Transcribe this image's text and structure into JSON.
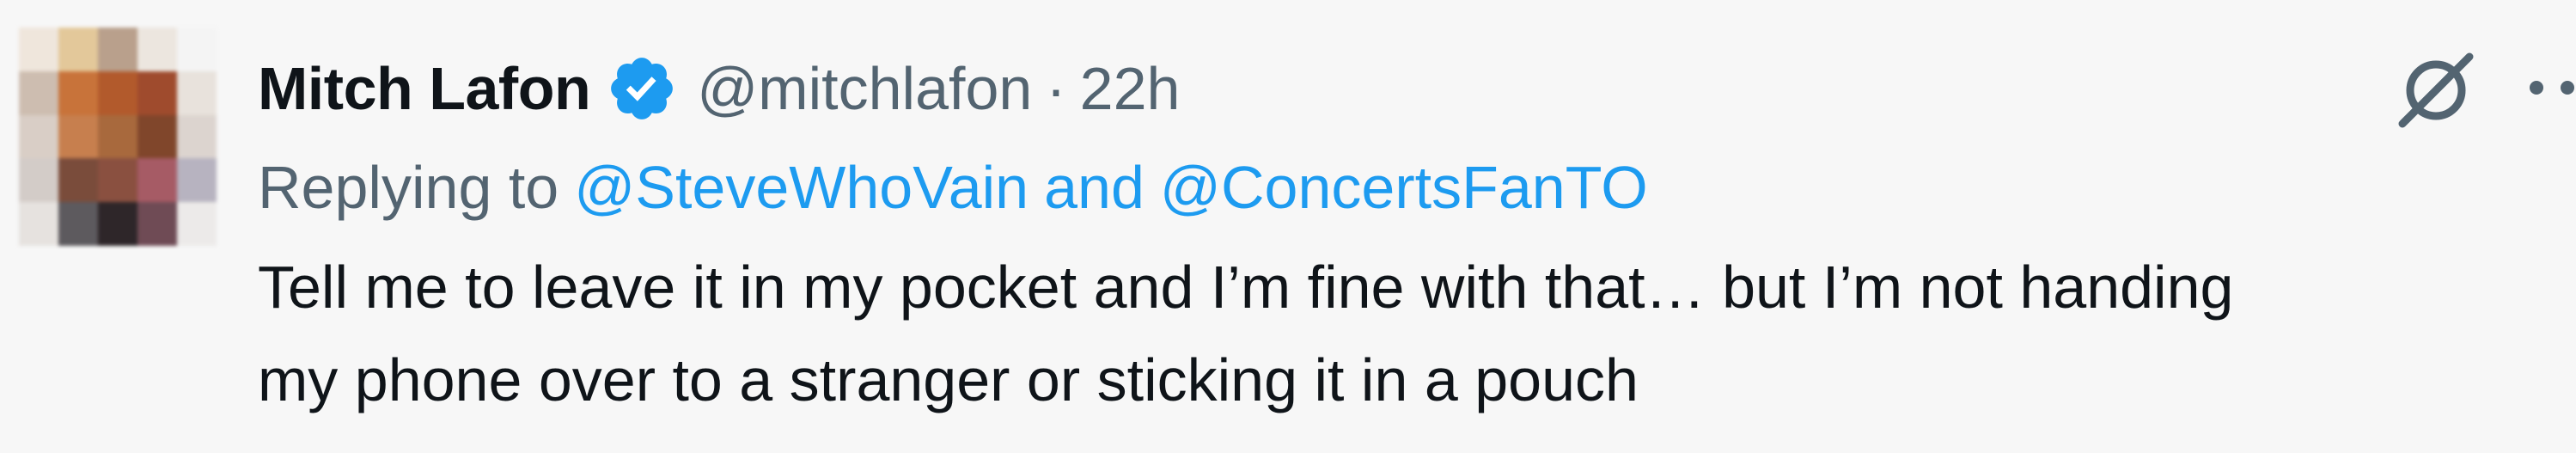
{
  "tweet": {
    "author": {
      "display_name": "Mitch Lafon",
      "handle": "@mitchlafon",
      "verified": true,
      "avatar_pixels": [
        [
          "#efe6dc",
          "#e3c89a",
          "#b9a08c",
          "#ece6df",
          "#f4f4f4"
        ],
        [
          "#cdbdb0",
          "#c8733a",
          "#b25a2c",
          "#9f4b2d",
          "#e8e2dc"
        ],
        [
          "#d9cec6",
          "#c77f4e",
          "#a8693d",
          "#80462b",
          "#dcd4cf"
        ],
        [
          "#d3ccc8",
          "#7a4c3b",
          "#8a5040",
          "#a65b65",
          "#b7b3c0"
        ],
        [
          "#e6e2df",
          "#5d5a5e",
          "#2e2629",
          "#6f4b55",
          "#eceae9"
        ]
      ]
    },
    "separator": "·",
    "timestamp": "22h",
    "grok_icon": "grok-slash-circle-icon",
    "more_icon": "more-dots-icon",
    "reply_context": {
      "prefix": "Replying to",
      "mentions": [
        "@SteveWhoVain",
        "@ConcertsFanTO"
      ],
      "joiner": "and"
    },
    "text_lines": [
      "Tell me to leave it in my pocket and I’m fine with that… but I’m not handing",
      "my phone over to a stranger or sticking it in a pouch"
    ],
    "colors": {
      "background": "#f7f7f7",
      "text": "#0f1419",
      "secondary": "#536471",
      "accent": "#1d9bf0",
      "verified": "#1d9bf0"
    }
  }
}
